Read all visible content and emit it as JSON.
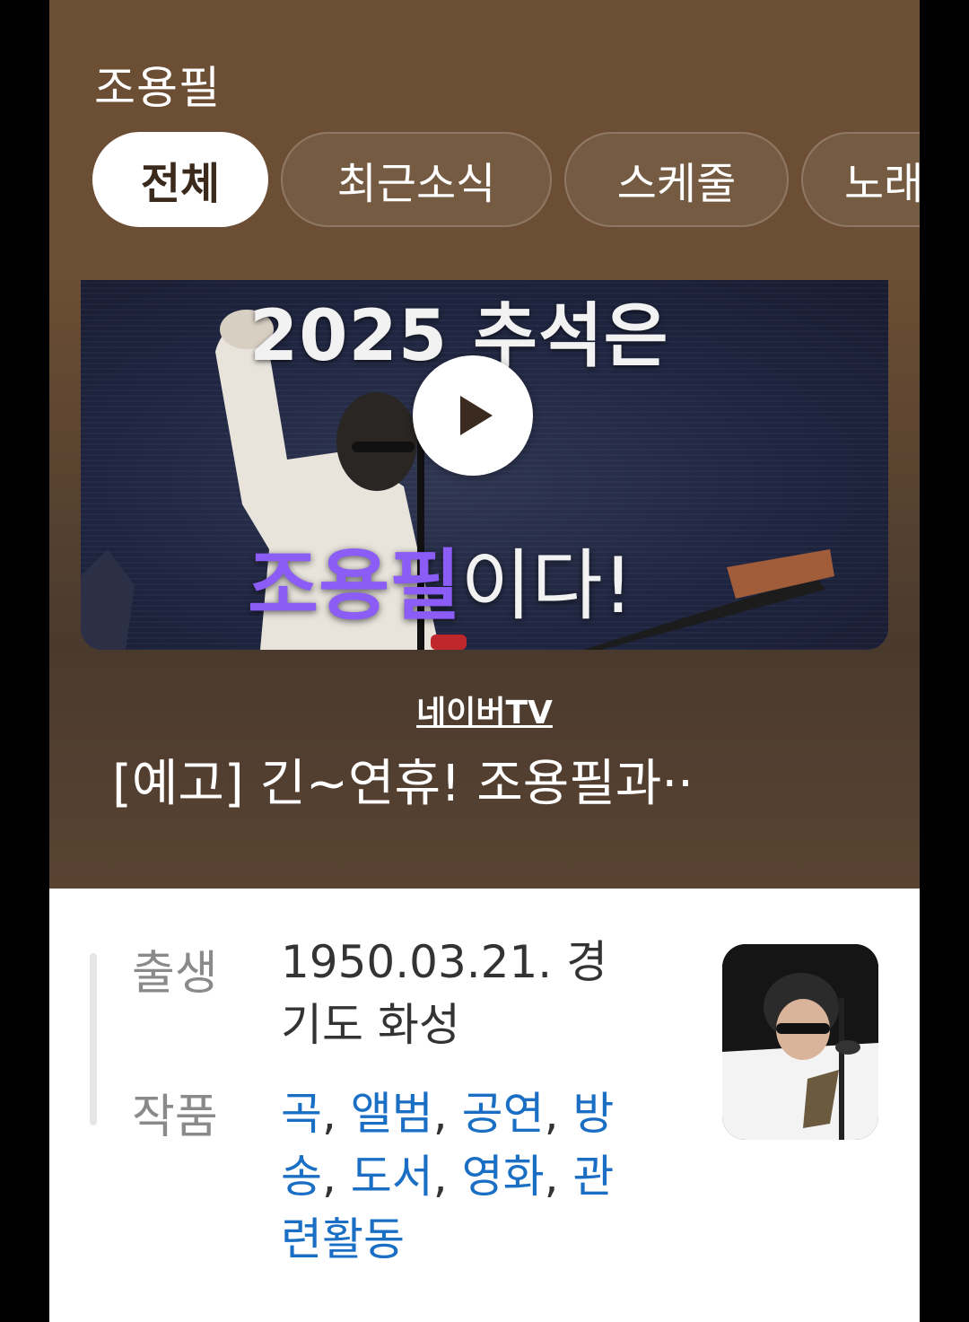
{
  "header": {
    "title": "조용필",
    "tabs": [
      {
        "label": "전체",
        "active": true
      },
      {
        "label": "최근소식",
        "active": false
      },
      {
        "label": "스케줄",
        "active": false
      },
      {
        "label": "노래",
        "active": false
      }
    ]
  },
  "video": {
    "overlay_top": "2025 추석은",
    "overlay_name": "조용필",
    "overlay_suffix": "이다!",
    "play_icon": "play-icon"
  },
  "feature": {
    "source": "네이버TV",
    "caption": "[예고] 긴~연휴! 조용필과··"
  },
  "profile": {
    "birth_label": "출생",
    "birth_value": "1950.03.21. 경기도 화성",
    "works_label": "작품",
    "works": [
      "곡",
      "앨범",
      "공연",
      "방송",
      "도서",
      "영화",
      "관련활동"
    ]
  },
  "colors": {
    "header_bg": "#6b4e33",
    "link": "#1a6fc4",
    "accent_purple": "#8b5cf6"
  }
}
